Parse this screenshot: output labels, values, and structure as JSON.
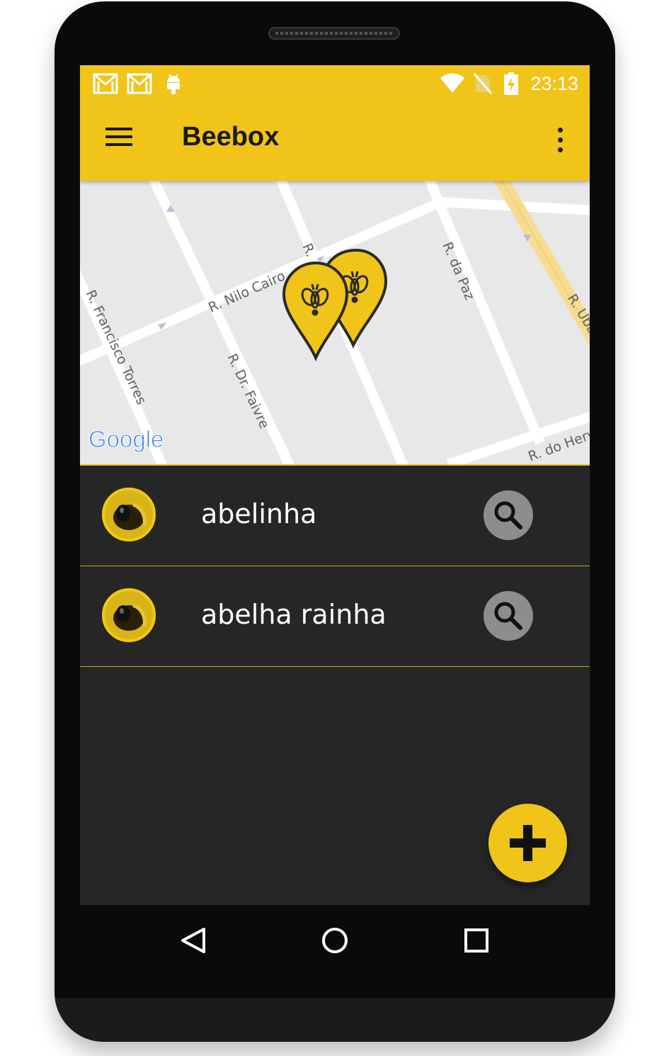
{
  "status_bar": {
    "time": "23:13",
    "icons": [
      "gmail-icon",
      "gmail-icon",
      "android-icon",
      "wifi-icon",
      "no-sim-icon",
      "battery-charging-icon"
    ]
  },
  "app_bar": {
    "title": "Beebox",
    "menu_icon": "hamburger-menu-icon",
    "overflow_icon": "more-vert-icon"
  },
  "map": {
    "provider_logo": "Google",
    "street_labels": [
      "R. Nilo Cairo",
      "R. Francisco Torres",
      "R. Dr. Faivre",
      "R. da Paz",
      "R. Ubar",
      "R. do Herv",
      "R."
    ],
    "marker_count": 2,
    "marker_icon": "bee-marker-icon"
  },
  "hives": [
    {
      "name": "abelinha",
      "avatar": "bee-avatar",
      "action_icon": "search-icon"
    },
    {
      "name": "abelha rainha",
      "avatar": "bee-avatar",
      "action_icon": "search-icon"
    }
  ],
  "fab": {
    "icon": "plus-icon"
  },
  "nav_bar": {
    "buttons": [
      "back-icon",
      "home-icon",
      "recents-icon"
    ]
  },
  "colors": {
    "accent": "#f0c419",
    "background": "#262626",
    "search_button": "#8d8d8d",
    "map_background": "#e8e8e8"
  }
}
